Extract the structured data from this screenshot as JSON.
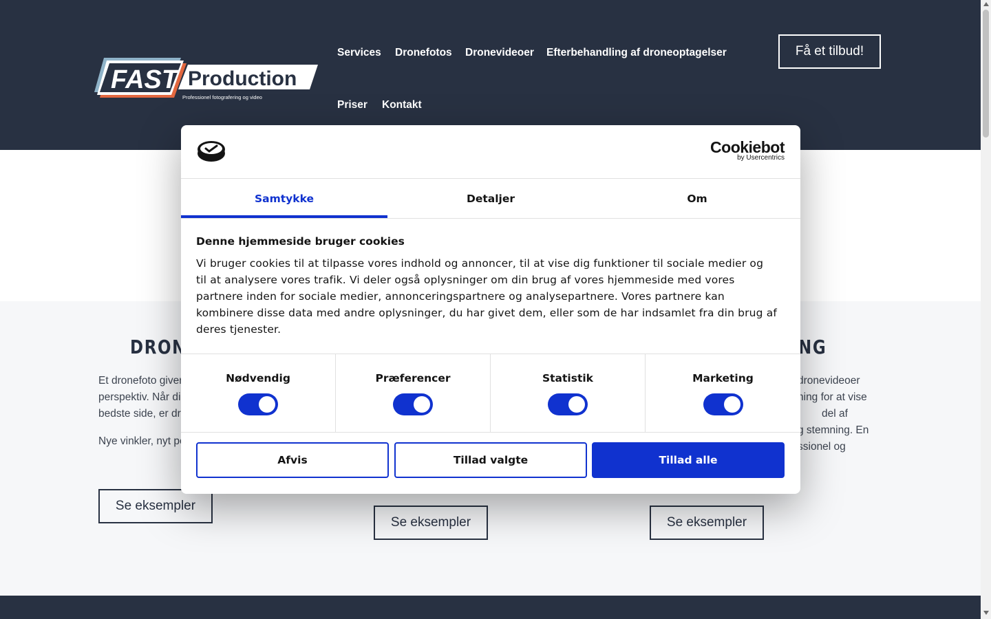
{
  "header": {
    "logo_fast": "FAST",
    "logo_production": "Production",
    "logo_tagline": "Professionel fotografering og video",
    "nav": [
      "Services",
      "Dronefotos",
      "Dronevideoer",
      "Efterbehandling af droneoptagelser",
      "Priser",
      "Kontakt"
    ],
    "cta": "Få et tilbud!"
  },
  "columns": {
    "left": {
      "heading_partial": "DRONE",
      "text_lines": [
        "Et dronefoto giver",
        "perspektiv. Når di",
        "bedste side, er dro"
      ],
      "text2": "Nye vinkler, nyt pe",
      "button": "Se eksempler"
    },
    "middle": {
      "button": "Se eksempler"
    },
    "right": {
      "heading_partial": "NG",
      "text_lines": [
        "dronevideoer",
        "ning for at vise",
        "del af",
        "g stemning. En",
        "ssionel og"
      ],
      "button": "Se eksempler"
    }
  },
  "cookie_dialog": {
    "brand_name": "Cookiebot",
    "brand_sub": "by Usercentrics",
    "tabs": [
      "Samtykke",
      "Detaljer",
      "Om"
    ],
    "active_tab": "Samtykke",
    "title": "Denne hjemmeside bruger cookies",
    "text_lines": [
      "Vi bruger cookies til at tilpasse vores indhold og annoncer, til at vise dig funktioner til sociale medier og",
      "til at analysere vores trafik. Vi deler også oplysninger om din brug af vores hjemmeside med vores",
      "partnere inden for sociale medier, annonceringspartnere og analysepartnere. Vores partnere kan",
      "kombinere disse data med andre oplysninger, du har givet dem, eller som de har indsamlet fra din brug af",
      "deres tjenester."
    ],
    "categories": [
      {
        "label": "Nødvendig",
        "enabled": true
      },
      {
        "label": "Præferencer",
        "enabled": true
      },
      {
        "label": "Statistik",
        "enabled": true
      },
      {
        "label": "Marketing",
        "enabled": true
      }
    ],
    "buttons": {
      "reject": "Afvis",
      "allow_selected": "Tillad valgte",
      "allow_all": "Tillad alle"
    }
  },
  "colors": {
    "header_bg": "#283142",
    "accent_blue": "#1032cf",
    "logo_light_blue": "#8fb3c9",
    "logo_orange": "#e2673f"
  }
}
